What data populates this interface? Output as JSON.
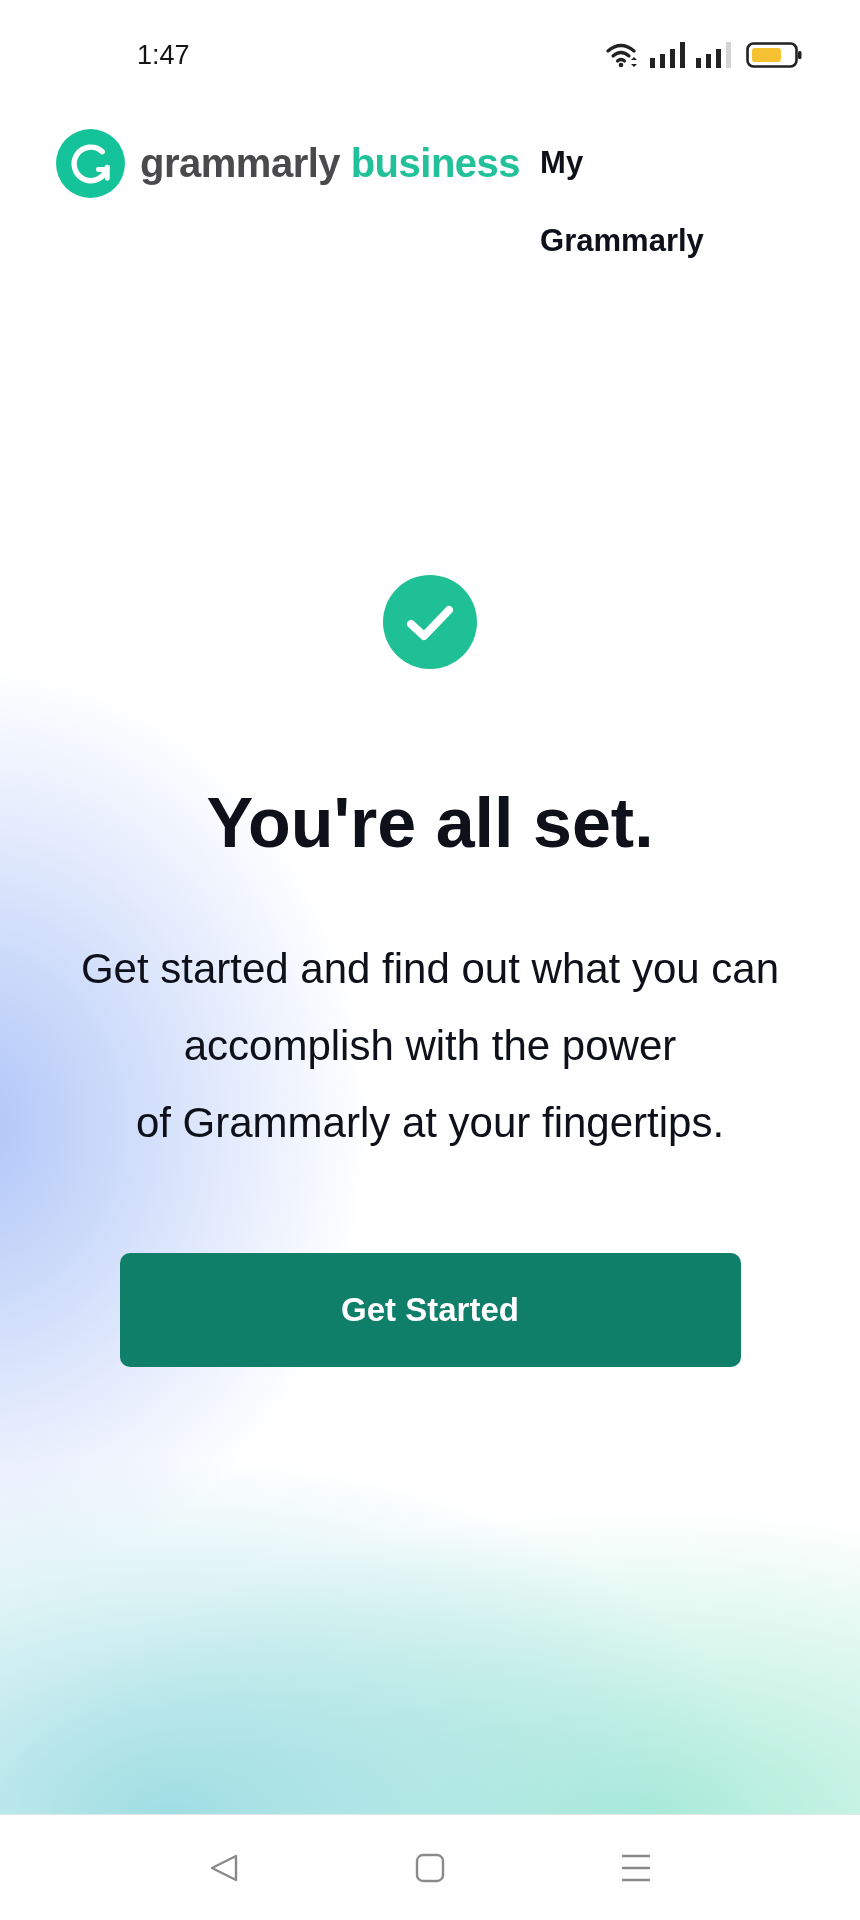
{
  "status_bar": {
    "time": "1:47"
  },
  "header": {
    "logo_word": "grammarly",
    "logo_suffix": "business",
    "nav_link": "My Grammarly"
  },
  "confirmation": {
    "title": "You're all set.",
    "body": "Get started and find out what you can\naccomplish with the power\nof Grammarly at your fingertips.",
    "button": "Get Started"
  }
}
